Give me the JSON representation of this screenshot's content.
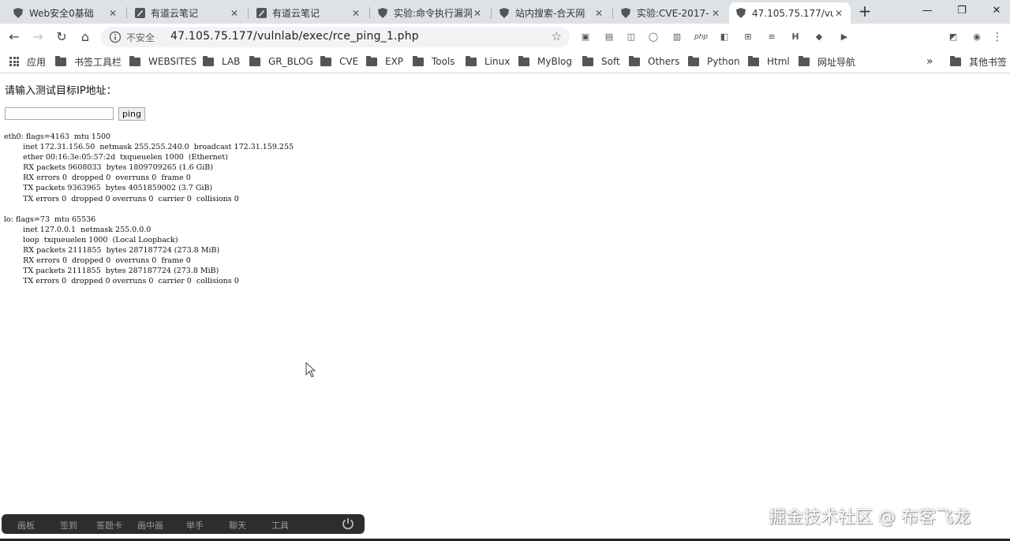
{
  "tabs": [
    {
      "label": "Web安全0基础",
      "icon": "shield-icon"
    },
    {
      "label": "有道云笔记",
      "icon": "note-icon"
    },
    {
      "label": "有道云笔记",
      "icon": "note-icon"
    },
    {
      "label": "实验:命令执行漏洞",
      "icon": "shield-icon"
    },
    {
      "label": "站内搜索-合天网",
      "icon": "shield-icon"
    },
    {
      "label": "实验:CVE-2017-",
      "icon": "shield-icon"
    },
    {
      "label": "47.105.75.177/vu",
      "icon": "shield-icon",
      "active": true
    }
  ],
  "address": {
    "not_secure": "不安全",
    "url": "47.105.75.177/vulnlab/exec/rce_ping_1.php"
  },
  "extensions": {
    "php": "php"
  },
  "bookmarks": {
    "apps": "应用",
    "items": [
      "书签工具栏",
      "WEBSITES",
      "LAB",
      "GR_BLOG",
      "CVE",
      "EXP",
      "Tools",
      "Linux",
      "MyBlog",
      "Soft",
      "Others",
      "Python",
      "Html",
      "网址导航"
    ],
    "more": "»",
    "other": "其他书签"
  },
  "page": {
    "prompt": "请输入测试目标IP地址：",
    "ip_value": "",
    "ping_label": "ping",
    "output": "eth0: flags=4163  mtu 1500\n        inet 172.31.156.50  netmask 255.255.240.0  broadcast 172.31.159.255\n        ether 00:16:3e:05:57:2d  txqueuelen 1000  (Ethernet)\n        RX packets 9608033  bytes 1809709265 (1.6 GiB)\n        RX errors 0  dropped 0  overruns 0  frame 0\n        TX packets 9363965  bytes 4051859002 (3.7 GiB)\n        TX errors 0  dropped 0 overruns 0  carrier 0  collisions 0\n\nlo: flags=73  mtu 65536\n        inet 127.0.0.1  netmask 255.0.0.0\n        loop  txqueuelen 1000  (Local Loopback)\n        RX packets 2111855  bytes 287187724 (273.8 MiB)\n        RX errors 0  dropped 0  overruns 0  frame 0\n        TX packets 2111855  bytes 287187724 (273.8 MiB)\n        TX errors 0  dropped 0 overruns 0  carrier 0  collisions 0"
  },
  "dock": {
    "items": [
      "画板",
      "签到",
      "答题卡",
      "画中画",
      "举手",
      "聊天",
      "工具"
    ]
  },
  "watermark": "掘金技术社区 @ 布客飞龙",
  "colors": {
    "tabbar": "#dee1e6",
    "dock": "#2d2d2d",
    "omnibox": "#f1f3f4"
  }
}
